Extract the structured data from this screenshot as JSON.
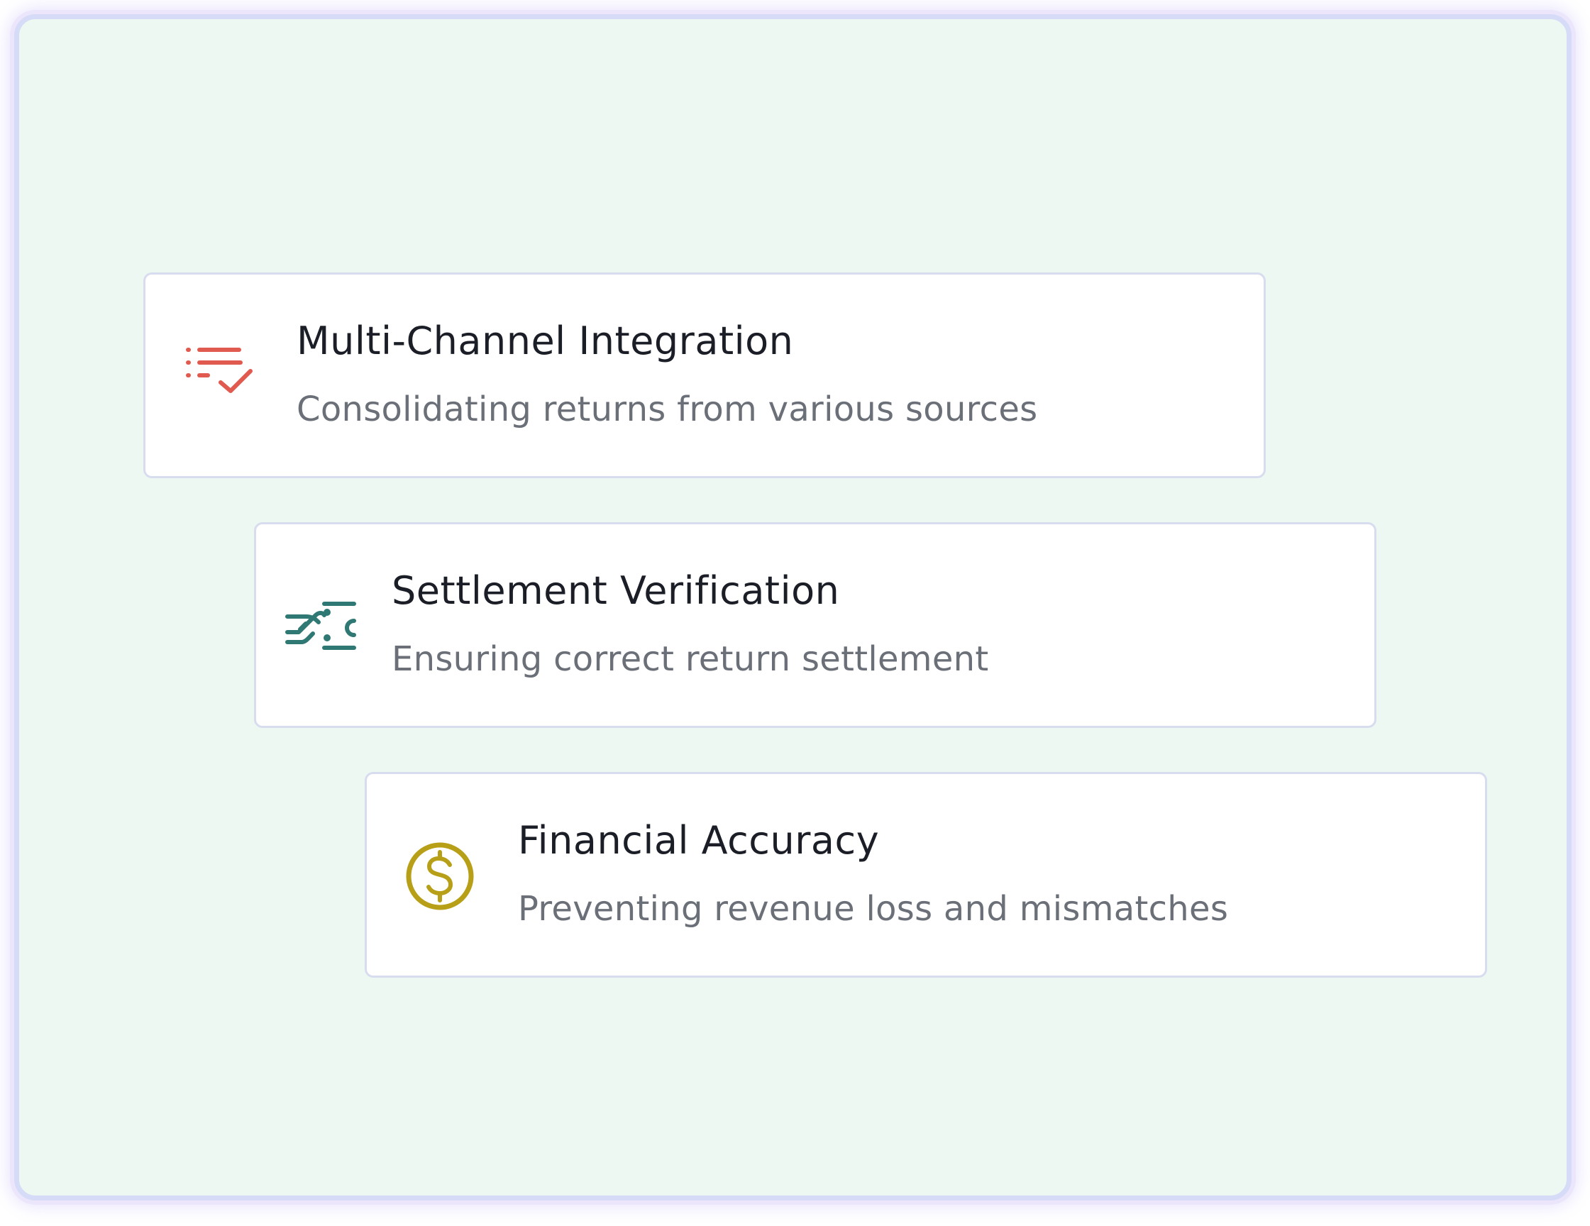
{
  "cards": [
    {
      "title": "Multi-Channel Integration",
      "subtitle": "Consolidating returns from various sources",
      "icon": "checklist-icon",
      "icon_color": "#e15a4f"
    },
    {
      "title": "Settlement Verification",
      "subtitle": "Ensuring correct return settlement",
      "icon": "handshake-money-icon",
      "icon_color": "#2f7873"
    },
    {
      "title": "Financial Accuracy",
      "subtitle": "Preventing revenue loss and mismatches",
      "icon": "dollar-circle-icon",
      "icon_color": "#b7a017"
    }
  ],
  "colors": {
    "background": "#ecf8f1",
    "card_border": "#d8dcef",
    "title": "#1b1e26",
    "subtitle": "#6b6f78"
  }
}
